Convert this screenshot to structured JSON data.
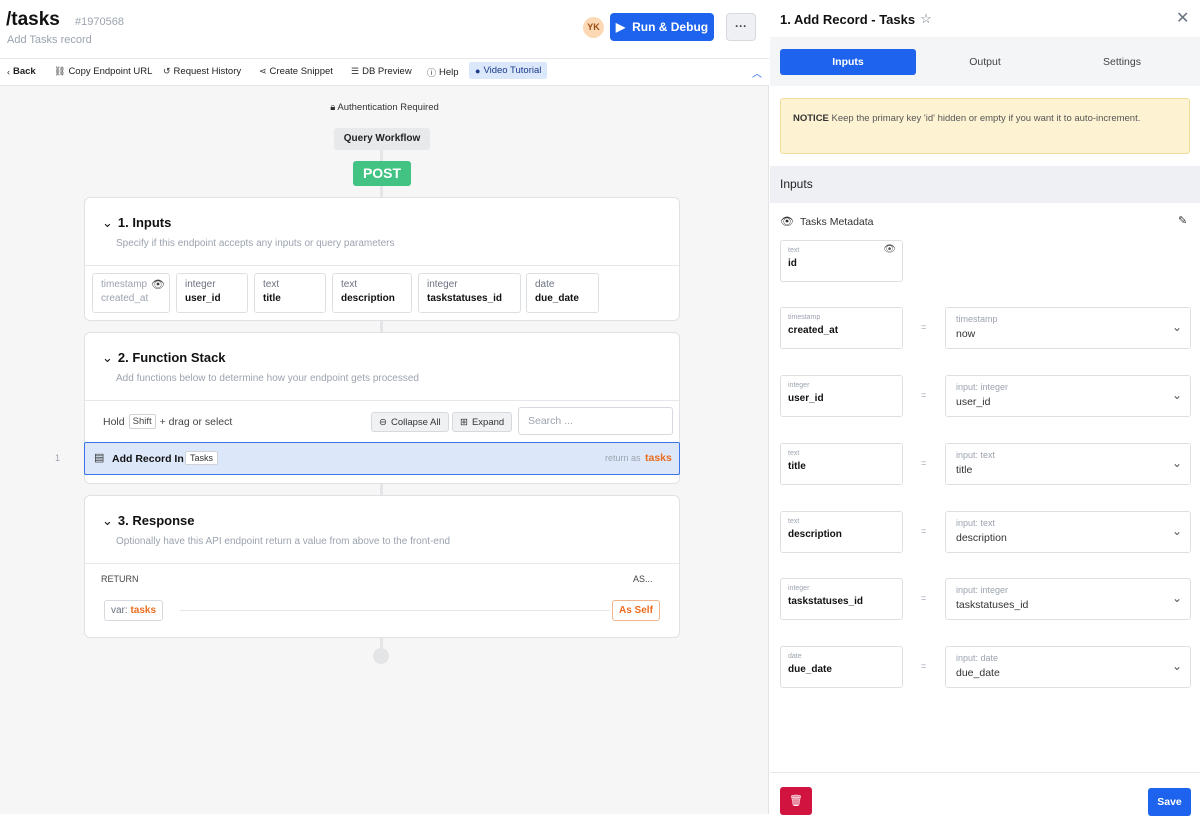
{
  "header": {
    "title": "/tasks",
    "id": "#1970568",
    "subtitle": "Add Tasks record",
    "avatar": "YK",
    "run_label": "Run & Debug",
    "more_label": "···"
  },
  "toolbar": {
    "back": "Back",
    "copy_url": "Copy Endpoint URL",
    "history": "Request History",
    "snippet": "Create Snippet",
    "db_preview": "DB Preview",
    "help": "Help",
    "video": "Video Tutorial"
  },
  "workflow": {
    "auth": "Authentication Required",
    "query": "Query Workflow",
    "method": "POST"
  },
  "inputs_card": {
    "title": "1. Inputs",
    "desc": "Specify if this endpoint accepts any inputs or query parameters",
    "items": [
      {
        "type": "timestamp",
        "name": "created_at"
      },
      {
        "type": "integer",
        "name": "user_id"
      },
      {
        "type": "text",
        "name": "title"
      },
      {
        "type": "text",
        "name": "description"
      },
      {
        "type": "integer",
        "name": "taskstatuses_id"
      },
      {
        "type": "date",
        "name": "due_date"
      }
    ]
  },
  "function_card": {
    "title": "2. Function Stack",
    "desc": "Add functions below to determine how your endpoint gets processed",
    "hold": "Hold",
    "shift": "Shift",
    "drag_hint": "+ drag or select",
    "collapse_all": "Collapse All",
    "expand": "Expand",
    "search_placeholder": "Search ...",
    "row_num": "1",
    "row_name": "Add Record In",
    "row_table": "Tasks",
    "return_as": "return as",
    "return_var": "tasks"
  },
  "response_card": {
    "title": "3. Response",
    "desc": "Optionally have this API endpoint return a value from above to the front-end",
    "return_label": "RETURN",
    "as_label": "AS...",
    "var_prefix": "var:",
    "var_name": "tasks",
    "as_value": "As Self"
  },
  "panel": {
    "title": "1. Add Record - Tasks",
    "tabs": [
      "Inputs",
      "Output",
      "Settings"
    ],
    "notice_bold": "NOTICE",
    "notice_text": "Keep the primary key 'id' hidden or empty if you want it to auto-increment.",
    "section": "Inputs",
    "meta_label": "Tasks Metadata",
    "id_field": {
      "type": "text",
      "name": "id"
    },
    "fields": [
      {
        "type": "timestamp",
        "name": "created_at",
        "value_type": "timestamp",
        "value": "now"
      },
      {
        "type": "integer",
        "name": "user_id",
        "value_type": "input: integer",
        "value": "user_id"
      },
      {
        "type": "text",
        "name": "title",
        "value_type": "input: text",
        "value": "title"
      },
      {
        "type": "text",
        "name": "description",
        "value_type": "input: text",
        "value": "description"
      },
      {
        "type": "integer",
        "name": "taskstatuses_id",
        "value_type": "input: integer",
        "value": "taskstatuses_id"
      },
      {
        "type": "date",
        "name": "due_date",
        "value_type": "input: date",
        "value": "due_date"
      }
    ],
    "eq": "=",
    "save": "Save"
  }
}
